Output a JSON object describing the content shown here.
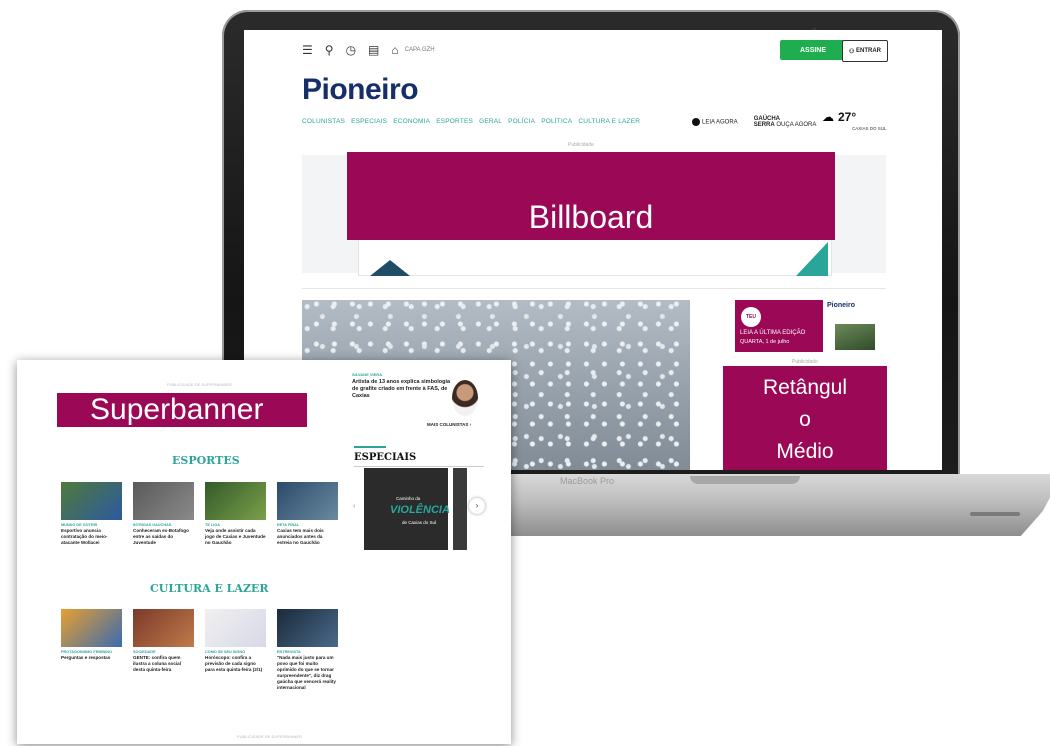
{
  "laptop": {
    "brand": "MacBook Pro",
    "toolbar": {
      "capa_label": "CAPA GZH",
      "assine_label": "ASSINE",
      "entrar_label": "ENTRAR"
    },
    "logo": "Pioneiro",
    "nav": [
      "COLUNISTAS",
      "ESPECIAIS",
      "ECONOMIA",
      "ESPORTES",
      "GERAL",
      "POLÍCIA",
      "POLÍTICA",
      "CULTURA E LAZER"
    ],
    "right_nav": {
      "leia": "LEIA AGORA",
      "gaucha_1": "GAÚCHA",
      "gaucha_2": "SERRA",
      "ouca": "OUÇA AGORA"
    },
    "weather": {
      "temp": "27°",
      "city": "CAXIAS DO SUL"
    },
    "publicidade": "Publicidade",
    "billboard_label": "Billboard",
    "edition": {
      "badge_1": "TEU",
      "t1": "LEIA A ÚLTIMA EDIÇÃO",
      "t2": "QUARTA, 1 de julho",
      "logo": "Pioneiro"
    },
    "retangulo_lines": [
      "Retângul",
      "o",
      "Médio"
    ]
  },
  "fg": {
    "top_text": "PUBLICIDADE DE SUPERBANNER",
    "superbanner_label": "Superbanner",
    "columnist": {
      "tag": "SILVANE VIERA",
      "text": "Artista de 13 anos explica simbologia de grafite criado em frente à FAS, de Caxias",
      "more": "MAIS COLUNISTAS"
    },
    "especiais": {
      "heading": "ESPECIAIS",
      "sub": "Caminho da",
      "title": "VIOLÊNCIA",
      "sub2": "de Caxias do Sul"
    },
    "esportes": {
      "heading": "ESPORTES",
      "cards": [
        {
          "tag": "MUNDO DE GOTEIR",
          "text": "Esportivo anuncia contratação do meio-atacante Wollacei",
          "color1": "#4f7a3a",
          "color2": "#2c5aa0"
        },
        {
          "tag": "INTRIGAS GAÚCHAS",
          "text": "Conheceram ex-Botafogo entre as saídas do Juventude",
          "color1": "#5a5a5a",
          "color2": "#8a8a8a"
        },
        {
          "tag": "TE LIGA",
          "text": "Veja onde assistir cada jogo de Caxias e Juventude no Gauchão",
          "color1": "#345a2a",
          "color2": "#7aa04a"
        },
        {
          "tag": "RETA FINAL",
          "text": "Caxias tem mais dois anunciados antes da estreia no Gauchão",
          "color1": "#2a4a6a",
          "color2": "#6a8aa0"
        }
      ]
    },
    "cultura": {
      "heading": "CULTURA E LAZER",
      "cards": [
        {
          "tag": "PROTAGONISMO FEMININO",
          "text": "Perguntas e respostas",
          "color1": "#e8a030",
          "color2": "#3a6ab0"
        },
        {
          "tag": "SOCIEDADE",
          "text": "GENTE: confira quem ilustra a coluna social desta quinta-feira",
          "color1": "#7a3a2a",
          "color2": "#c07a4a"
        },
        {
          "tag": "COMO SE SEU SIGNO",
          "text": "Horóscopo: confira a previsão de cada signo para esta quinta-feira (2/1)",
          "color1": "#f0f0f0",
          "color2": "#d8d8e8"
        },
        {
          "tag": "ENTREVISTA",
          "text": "\"Nada mais justo para um povo que foi muito oprimido do que se tornar surpreendente\", diz drag gaúcha que vencerá reality internacional",
          "color1": "#1a2a3a",
          "color2": "#4a6a8a"
        }
      ]
    },
    "bottom_text": "PUBLICIDADE DE SUPERBANNER"
  },
  "colors": {
    "magenta": "#9b0856",
    "teal": "#2aa59a",
    "navy": "#162f6a",
    "green": "#1fae4f"
  }
}
